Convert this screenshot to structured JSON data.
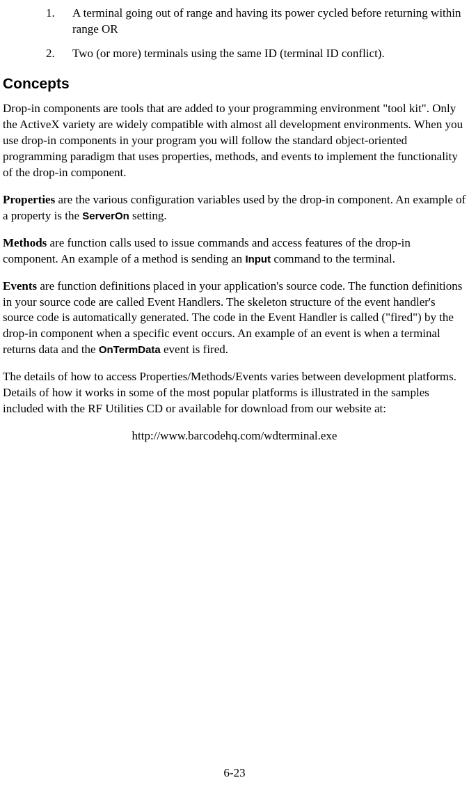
{
  "list": {
    "item1_num": "1.",
    "item1_text": "A terminal going out of range and having its power cycled before returning within range OR",
    "item2_num": "2.",
    "item2_text": "Two (or more) terminals using the same ID (terminal ID conflict)."
  },
  "heading": "Concepts",
  "para_dropin": "Drop-in components are tools that are added to your programming environment \"tool kit\". Only the ActiveX variety are widely compatible with almost all development environments. When you use drop-in components in your program you will follow the standard object-oriented programming paradigm that uses properties, methods, and events to implement the functionality of the drop-in component.",
  "properties": {
    "term": "Properties",
    "before": " are the various configuration variables used by the drop-in component. An example of a property is the ",
    "code": "ServerOn",
    "after": " setting."
  },
  "methods": {
    "term": "Methods",
    "before": " are function calls used to issue commands and access features of the drop-in component. An example of a method is sending an ",
    "code": "Input",
    "after": " command to the terminal."
  },
  "events": {
    "term": "Events",
    "before": " are function definitions placed in your application's source code. The function definitions in your source code are called Event Handlers. The skeleton structure of the event handler's source code is automatically generated. The code in the Event Handler is called (\"fired\") by the drop-in component when a specific event occurs. An example of an event is when a terminal returns data and the ",
    "code": "OnTermData",
    "after": " event is fired."
  },
  "para_details": "The details of how to access Properties/Methods/Events varies between development platforms. Details of how it works in some of the most popular platforms is illustrated in the samples included with the RF Utilities CD or available for download from our website at:",
  "url": "http://www.barcodehq.com/wdterminal.exe",
  "page_number": "6-23"
}
